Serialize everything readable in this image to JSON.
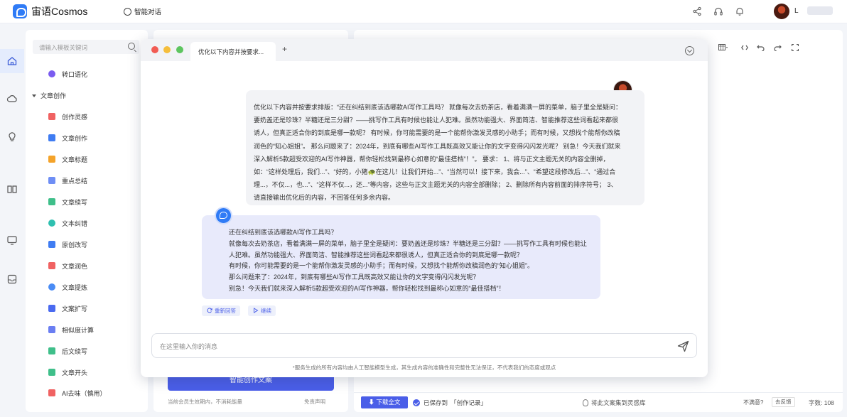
{
  "app": {
    "name": "宙语Cosmos",
    "nav_label": "智能对话",
    "user_initial": "L"
  },
  "sidebar": {
    "search_placeholder": "请输入模板关键词",
    "top_item": "转口语化",
    "group_label": "文章创作",
    "items": [
      {
        "label": "创作灵感",
        "color": "#f06262"
      },
      {
        "label": "文章创作",
        "color": "#3f7cf2"
      },
      {
        "label": "文章标题",
        "color": "#f4a32a"
      },
      {
        "label": "重点总结",
        "color": "#6e8ef5"
      },
      {
        "label": "文章续写",
        "color": "#3fbf8a"
      },
      {
        "label": "文本纠错",
        "color": "#2fc0b0"
      },
      {
        "label": "原创改写",
        "color": "#3f7cf2"
      },
      {
        "label": "文章润色",
        "color": "#f06262"
      },
      {
        "label": "文章提炼",
        "color": "#4a8cf5"
      },
      {
        "label": "文案扩写",
        "color": "#4a6af0"
      },
      {
        "label": "相似度计算",
        "color": "#6a7ef2"
      },
      {
        "label": "后文续写",
        "color": "#3fbf8a"
      },
      {
        "label": "文章开头",
        "color": "#3fbf8a"
      },
      {
        "label": "AI去味（慎用）",
        "color": "#f06262"
      }
    ]
  },
  "middle": {
    "generate_button": "智能创作文案",
    "footer_left": "当前会员生效期内，不消耗能量",
    "footer_right": "免责声明"
  },
  "editor": {
    "download_button": "下载全文",
    "saved_prefix": "已保存到",
    "saved_target": "「创作记录」",
    "collect_label": "将此文案集到灵感库",
    "unsatisfied": "不满意?",
    "feedback": "去反馈",
    "word_count": "字数: 108"
  },
  "chat": {
    "tab_title": "优化以下内容并按要求...",
    "user_message": "优化以下内容并按要求排版：“还在纠结到底该选哪款AI写作工具吗？ 就像每次去奶茶店，看着满满一屏的菜单，脑子里全是疑问：要奶盖还是珍珠？半糖还是三分甜？——挑写作工具有时候也能让人犯难。虽然功能强大、界面简洁、智能推荐这些词看起来都很诱人，但真正适合你的到底是哪一款呢？ 有时候，你可能需要的是一个能帮你激发灵感的小助手；而有时候，又想找个能帮你改稿润色的“知心姐姐”。 那么问题来了：2024年，到底有哪些AI写作工具既高效又能让你的文字变得闪闪发光呢？ 别急！今天我们就来深入解析5款超受欢迎的AI写作神器，帮你轻松找到最称心如意的“最佳搭档”！”。 要求： 1、将与正文主题无关的内容全删掉，如：“这样处理后，我们...”、“好的，小猪🐢在这儿！让我们开始...”、“当然可以！接下来，我会...”、“希望这段修改后...”、“通过合理...，不仅...，也...”、“这样不仅...，还...”等内容，这些与正文主题无关的内容全部删除； 2、删除所有内容前面的排序符号； 3、请直接输出优化后的内容，不回答任何多余内容。",
    "ai_lines": [
      "还在纠结到底该选哪款AI写作工具吗？",
      "就像每次去奶茶店，看着满满一屏的菜单，脑子里全是疑问：要奶盖还是珍珠？半糖还是三分甜？——挑写作工具有时候也能让人犯难。虽然功能强大、界面简洁、智能推荐这些词看起来都很诱人，但真正适合你的到底是哪一款呢？",
      "有时候，你可能需要的是一个能帮你激发灵感的小助手；而有时候，又想找个能帮你改稿润色的“知心姐姐”。",
      "那么问题来了：2024年，到底有哪些AI写作工具既高效又能让你的文字变得闪闪发光呢？",
      "别急！今天我们就来深入解析5款超受欢迎的AI写作神器，帮你轻松找到最称心如意的“最佳搭档”！"
    ],
    "regenerate": "重新回答",
    "continue": "继续",
    "input_placeholder": "在这里输入你的消息",
    "disclaimer": "*服务生成的所有内容均由人工智能模型生成，其生成内容的准确性和完整性无法保证，不代表我们的态度或观点"
  },
  "colors": {
    "accent": "#4a5ee8",
    "brand": "#2f7bf6",
    "ai_bubble": "#e8eafb",
    "user_bubble": "#f2f3f6"
  }
}
